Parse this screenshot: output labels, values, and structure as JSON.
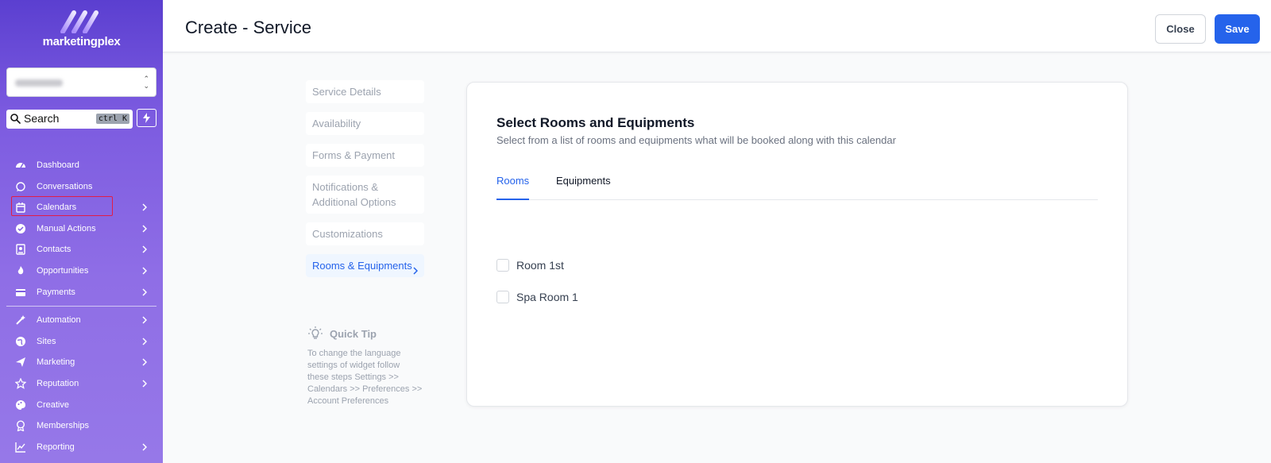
{
  "app": {
    "brand": "marketingplex"
  },
  "search": {
    "label": "Search",
    "shortcut": "ctrl K"
  },
  "sidebar": {
    "items": [
      {
        "label": "Dashboard",
        "icon": "dashboard-icon",
        "chevron": false
      },
      {
        "label": "Conversations",
        "icon": "chat-icon",
        "chevron": false
      },
      {
        "label": "Calendars",
        "icon": "calendar-icon",
        "chevron": true
      },
      {
        "label": "Manual Actions",
        "icon": "check-circle-icon",
        "chevron": true
      },
      {
        "label": "Contacts",
        "icon": "contacts-icon",
        "chevron": true
      },
      {
        "label": "Opportunities",
        "icon": "flame-icon",
        "chevron": true
      },
      {
        "label": "Payments",
        "icon": "credit-card-icon",
        "chevron": true
      }
    ],
    "items2": [
      {
        "label": "Automation",
        "icon": "magic-wand-icon",
        "chevron": true
      },
      {
        "label": "Sites",
        "icon": "globe-icon",
        "chevron": true
      },
      {
        "label": "Marketing",
        "icon": "paper-plane-icon",
        "chevron": true
      },
      {
        "label": "Reputation",
        "icon": "star-icon",
        "chevron": true
      },
      {
        "label": "Creative",
        "icon": "palette-icon",
        "chevron": false
      },
      {
        "label": "Memberships",
        "icon": "award-icon",
        "chevron": false
      },
      {
        "label": "Reporting",
        "icon": "chart-icon",
        "chevron": true
      }
    ]
  },
  "header": {
    "title": "Create - Service",
    "close_label": "Close",
    "save_label": "Save"
  },
  "steps": {
    "items": [
      {
        "label": "Service Details"
      },
      {
        "label": "Availability"
      },
      {
        "label": "Forms & Payment"
      },
      {
        "label": "Notifications & Additional Options"
      },
      {
        "label": "Customizations"
      },
      {
        "label": "Rooms & Equipments"
      }
    ]
  },
  "tip": {
    "title": "Quick Tip",
    "body": "To change the language settings of widget follow these steps Settings >> Calendars >> Preferences >> Account Preferences"
  },
  "card": {
    "title": "Select Rooms and Equipments",
    "subtitle": "Select from a list of rooms and equipments what will be booked along with this calendar",
    "tabs": [
      {
        "label": "Rooms"
      },
      {
        "label": "Equipments"
      }
    ],
    "rooms": [
      {
        "label": "Room 1st",
        "checked": false
      },
      {
        "label": "Spa Room 1",
        "checked": false
      }
    ]
  },
  "colors": {
    "accent": "#2563eb",
    "sidebar_top": "#5b3fd0",
    "sidebar_bottom": "#9678e8",
    "highlight": "#e11d48"
  }
}
